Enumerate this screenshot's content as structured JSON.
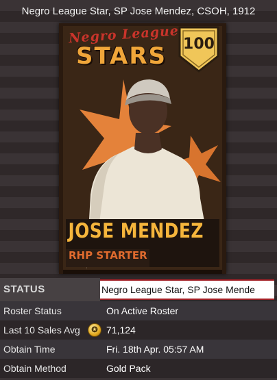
{
  "header": {
    "title": "Negro League Star, SP Jose Mendez, CSOH, 1912"
  },
  "card": {
    "brand_top": "Negro League",
    "brand_main": "STARS",
    "rating": "100",
    "player_name": "JOSE MENDEZ",
    "position": "RHP STARTER",
    "colors": {
      "accent": "#f5b53c",
      "star": "#e4823a",
      "banner": "#c9342b"
    }
  },
  "info": {
    "status_label": "STATUS",
    "status_value": "Negro League Star, SP Jose Mende",
    "rows": [
      {
        "label": "Roster Status",
        "value": "On Active Roster"
      },
      {
        "label": "Last 10 Sales Avg",
        "value": "71,124",
        "icon": "stubs-coin-icon"
      },
      {
        "label": "Obtain Time",
        "value": "Fri. 18th Apr. 05:57 AM"
      },
      {
        "label": "Obtain Method",
        "value": "Gold Pack"
      }
    ]
  }
}
